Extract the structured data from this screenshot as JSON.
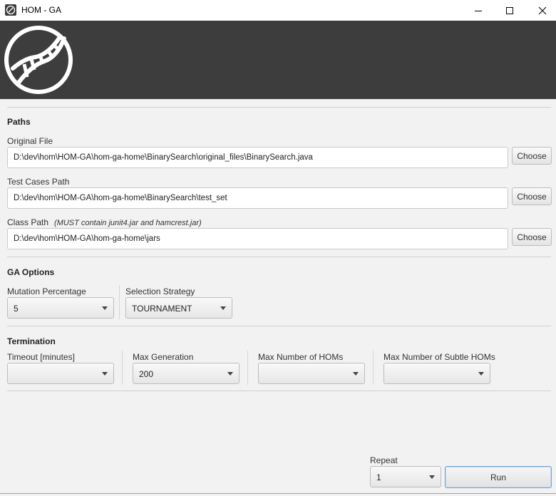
{
  "window": {
    "title": "HOM - GA"
  },
  "paths": {
    "section_title": "Paths",
    "original_file": {
      "label": "Original File",
      "value": "D:\\dev\\hom\\HOM-GA\\hom-ga-home\\BinarySearch\\original_files\\BinarySearch.java",
      "button": "Choose"
    },
    "test_cases": {
      "label": "Test Cases Path",
      "value": "D:\\dev\\hom\\HOM-GA\\hom-ga-home\\BinarySearch\\test_set",
      "button": "Choose"
    },
    "class_path": {
      "label": "Class Path",
      "hint": "(MUST contain junit4.jar and hamcrest.jar)",
      "value": "D:\\dev\\hom\\HOM-GA\\hom-ga-home\\jars",
      "button": "Choose"
    }
  },
  "ga_options": {
    "section_title": "GA Options",
    "mutation_percentage": {
      "label": "Mutation Percentage",
      "value": "5"
    },
    "selection_strategy": {
      "label": "Selection Strategy",
      "value": "TOURNAMENT"
    }
  },
  "termination": {
    "section_title": "Termination",
    "timeout": {
      "label": "Timeout [minutes]",
      "value": ""
    },
    "max_generation": {
      "label": "Max Generation",
      "value": "200"
    },
    "max_homs": {
      "label": "Max Number of HOMs",
      "value": ""
    },
    "max_subtle_homs": {
      "label": "Max Number of Subtle HOMs",
      "value": ""
    }
  },
  "footer": {
    "repeat": {
      "label": "Repeat",
      "value": "1"
    },
    "run_label": "Run"
  },
  "colors": {
    "banner": "#3d3d3d",
    "background": "#f2f2f2",
    "accent": "#6d9fd8"
  },
  "icons": [
    "app-icon",
    "dna-logo-icon",
    "minimize-icon",
    "maximize-icon",
    "close-icon",
    "chevron-down-icon"
  ]
}
